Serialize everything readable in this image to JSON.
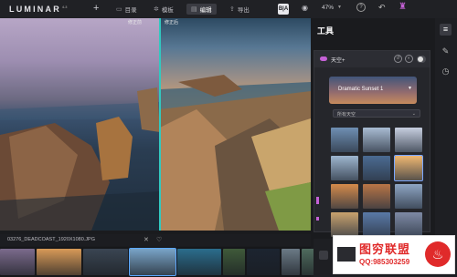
{
  "app": {
    "logo": "LUMINAR",
    "version": "4.3"
  },
  "nav": {
    "add_icon": "plus-icon",
    "items": [
      {
        "label": "目录",
        "icon": "folder-icon"
      },
      {
        "label": "模板",
        "icon": "template-icon"
      },
      {
        "label": "编辑",
        "icon": "edit-icon",
        "active": true
      },
      {
        "label": "导出",
        "icon": "export-icon"
      }
    ]
  },
  "topright": {
    "compare_label": "B|A",
    "zoom": "47%",
    "help": "?",
    "trophy_color": "#c561d6"
  },
  "canvas": {
    "before_label": "修正前",
    "after_label": "修正后",
    "split_color": "#31c9c0"
  },
  "panel": {
    "title": "工具",
    "tool_name": "天空+",
    "sky_selected": "Dramatic Sunset 1",
    "filter_label": "所有天空",
    "accent": "#c561d6"
  },
  "thumbs": [
    "#6f8fb3",
    "#a9bcd3",
    "#c7cfe0",
    "#9eb6cf",
    "#4b6b92",
    "#f0b872",
    "#d48a4b",
    "#b97546",
    "#8ea5c3",
    "#c9a26e",
    "#5a79a6",
    "#7e8aa5"
  ],
  "bottom": {
    "filename": "03276_DEADCOAST_1920X1080.JPG"
  },
  "film": [
    "#7b6b8c",
    "#d89a58",
    "#3a4552",
    "#79a4c8",
    "#2b6d8c",
    "#3f5a3a",
    "#1c2430",
    "#6b7a86",
    "#4f6b5e"
  ],
  "watermark": {
    "title": "图穷联盟",
    "sub": "QQ:985303259"
  }
}
